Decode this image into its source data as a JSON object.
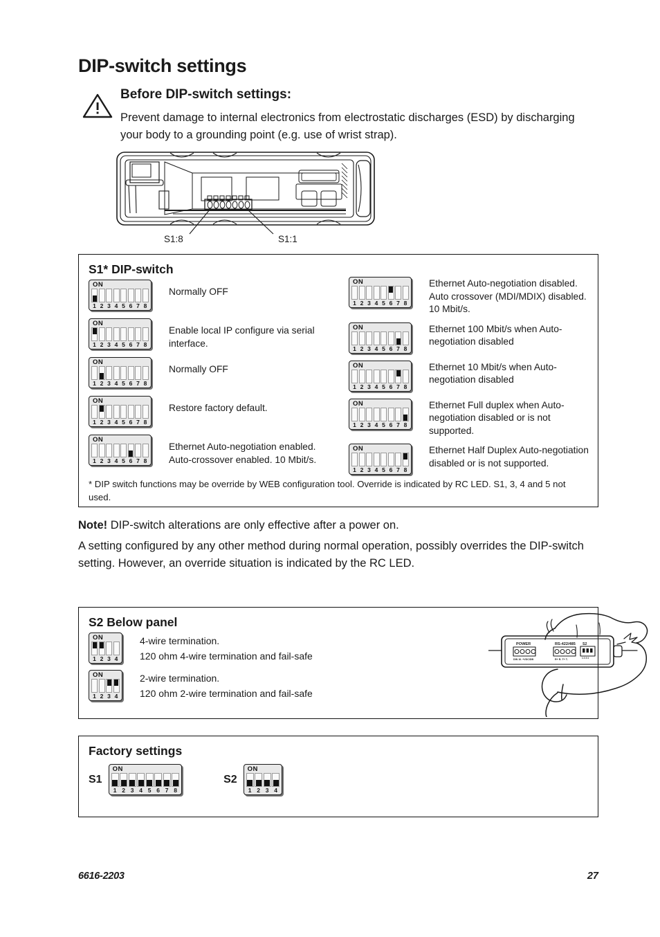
{
  "title": "DIP-switch settings",
  "warning": {
    "icon": "warning-triangle-icon",
    "heading": "Before DIP-switch settings:",
    "body": "Prevent damage to internal electronics from electrostatic discharges (ESD) by discharging your body to a grounding point (e.g. use of wrist strap)."
  },
  "device_illustration": {
    "callout_left": "S1:8",
    "callout_right": "S1:1"
  },
  "s1_box": {
    "title": "S1* DIP-switch",
    "labels": [
      "1",
      "2",
      "3",
      "4",
      "5",
      "6",
      "7",
      "8"
    ],
    "on_label": "ON",
    "left_rows": [
      {
        "positions": [
          "down",
          "",
          "",
          "",
          "",
          "",
          "",
          ""
        ],
        "desc": "Normally OFF"
      },
      {
        "positions": [
          "up",
          "",
          "",
          "",
          "",
          "",
          "",
          ""
        ],
        "desc": "Enable local IP configure via serial interface."
      },
      {
        "positions": [
          "",
          "down",
          "",
          "",
          "",
          "",
          "",
          ""
        ],
        "desc": "Normally OFF"
      },
      {
        "positions": [
          "",
          "up",
          "",
          "",
          "",
          "",
          "",
          ""
        ],
        "desc": "Restore factory default."
      },
      {
        "positions": [
          "",
          "",
          "",
          "",
          "",
          "down",
          "",
          ""
        ],
        "desc": "Ethernet Auto-negotiation enabled. Auto-crossover enabled. 10 Mbit/s."
      }
    ],
    "right_rows": [
      {
        "positions": [
          "",
          "",
          "",
          "",
          "",
          "up",
          "",
          ""
        ],
        "desc": "Ethernet Auto-negotiation disabled. Auto crossover (MDI/MDIX) disabled. 10 Mbit/s."
      },
      {
        "positions": [
          "",
          "",
          "",
          "",
          "",
          "",
          "down",
          ""
        ],
        "desc": "Ethernet 100 Mbit/s when Auto-negotiation disabled"
      },
      {
        "positions": [
          "",
          "",
          "",
          "",
          "",
          "",
          "up",
          ""
        ],
        "desc": "Ethernet 10 Mbit/s when Auto-negotiation disabled"
      },
      {
        "positions": [
          "",
          "",
          "",
          "",
          "",
          "",
          "",
          "down"
        ],
        "desc": "Ethernet Full duplex when Auto-negotiation disabled or is not supported."
      },
      {
        "positions": [
          "",
          "",
          "",
          "",
          "",
          "",
          "",
          "up"
        ],
        "desc": "Ethernet Half Duplex Auto-negotiation disabled or is not supported."
      }
    ],
    "footnote": "* DIP switch functions may be override by WEB configuration tool. Override is indicated by RC LED. S1, 3, 4 and 5 not used."
  },
  "note": {
    "bold": "Note!",
    "line": " DIP-switch alterations are only effective after a power on.",
    "paragraph": "A setting configured by any other method during normal operation, possibly overrides the DIP-switch setting. However, an override situation is indicated by the RC LED."
  },
  "s2_box": {
    "title": "S2 Below panel",
    "labels": [
      "1",
      "2",
      "3",
      "4"
    ],
    "on_label": "ON",
    "rows": [
      {
        "positions": [
          "up",
          "up",
          "",
          ""
        ],
        "line1": "4-wire termination.",
        "line2": "120 ohm 4-wire termination and fail-safe"
      },
      {
        "positions": [
          "",
          "",
          "up",
          "up"
        ],
        "line1": "2-wire termination.",
        "line2": "120 ohm 2-wire termination and fail-safe"
      }
    ],
    "illustration": {
      "power_label": "POWER",
      "serial_label": "RS-422/485",
      "s2_label": "S2",
      "power_pins": "DIN 10. +VDC/DB",
      "serial_pins": "R+  R-  T+  T-"
    }
  },
  "factory_box": {
    "title": "Factory settings",
    "on_label": "ON",
    "s1": {
      "label": "S1",
      "labels": [
        "1",
        "2",
        "3",
        "4",
        "5",
        "6",
        "7",
        "8"
      ],
      "positions": [
        "down",
        "down",
        "down",
        "down",
        "down",
        "down",
        "down",
        "down"
      ]
    },
    "s2": {
      "label": "S2",
      "labels": [
        "1",
        "2",
        "3",
        "4"
      ],
      "positions": [
        "down",
        "down",
        "down",
        "down"
      ]
    }
  },
  "footer": {
    "doc_number": "6616-2203",
    "page_number": "27"
  }
}
